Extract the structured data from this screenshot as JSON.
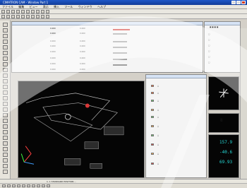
{
  "app": {
    "title": "CIMATRON CAM - Window Part 1",
    "menus": [
      "ファイル",
      "編集",
      "ビュー",
      "表示",
      "挿入",
      "ツール",
      "ウィンドウ",
      "ヘルプ"
    ]
  },
  "tables": {
    "rows": [
      [
        "0.000",
        "0.000"
      ],
      [
        "0.000",
        "0.000"
      ],
      [
        "0.000",
        "0.000"
      ],
      [
        "0.000",
        "0.000"
      ],
      [
        "0.000",
        "0.000"
      ],
      [
        "0.000",
        "0.000"
      ],
      [
        "0.000",
        "0.000"
      ],
      [
        "0.000",
        "0.000"
      ]
    ]
  },
  "status": {
    "text": "1. 1 STANDARD POSITION ..."
  },
  "readout": {
    "value1": "157.9",
    "value2": "-40.6",
    "value3": "69.93"
  }
}
